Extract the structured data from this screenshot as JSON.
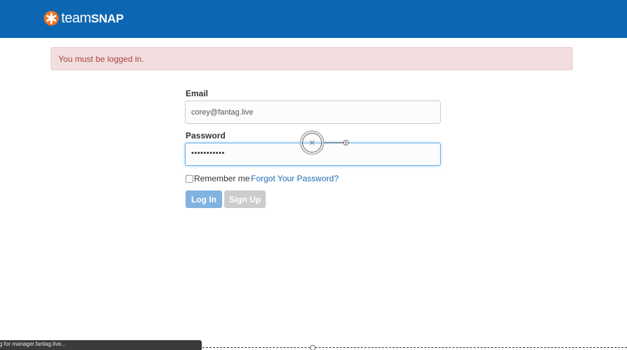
{
  "brand": {
    "name_part1": "team",
    "name_part2": "SNAP",
    "header_color": "#0d66b1",
    "logo_mark_color": "#f26f21"
  },
  "alert": {
    "message": "You must be logged in.",
    "type": "danger"
  },
  "form": {
    "email_label": "Email",
    "email_value": "corey@fantag.live",
    "password_label": "Password",
    "password_mask": "•••••••••••",
    "remember_label": "Remember me",
    "remember_checked": false,
    "forgot_link": "Forgot Your Password?",
    "login_button": "Log In",
    "signup_button": "Sign Up"
  },
  "status_bar": {
    "text": "g for manager.fantag.live..."
  },
  "icons": {
    "logo": "asterisk-logo-icon",
    "cursor": "drag-cursor-icon"
  }
}
